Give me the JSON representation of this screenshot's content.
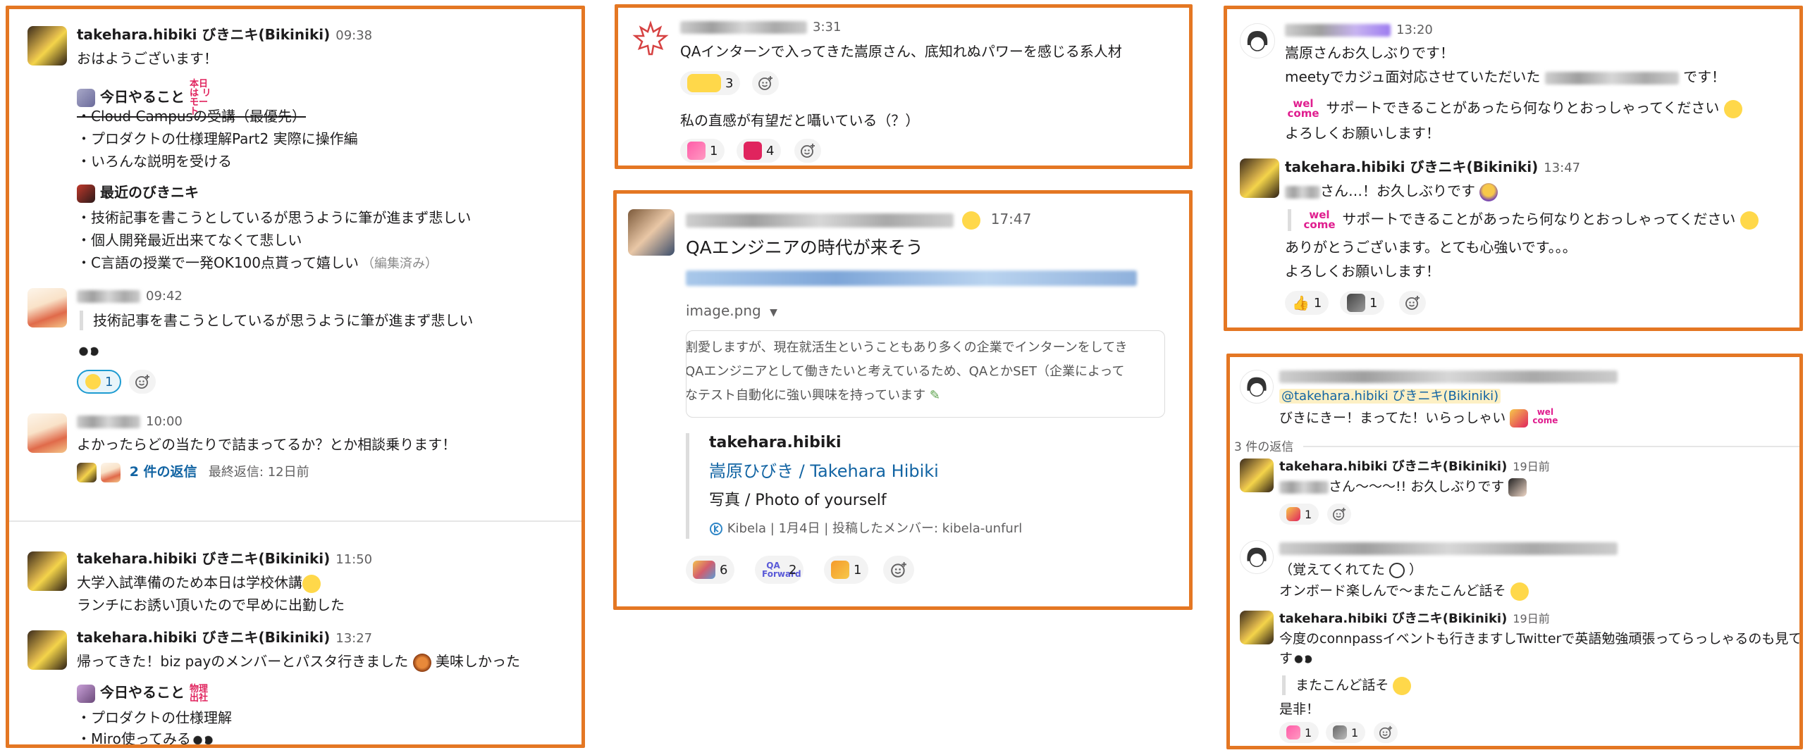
{
  "colors": {
    "panel_border": "#e47723",
    "link": "#1264a3",
    "muted": "#616061",
    "mention_bg": "#fdf0c4",
    "welcome_pink": "#e01e8f"
  },
  "p1": {
    "m1": {
      "name": "takehara.hibiki びきニキ(Bikiniki)",
      "time": "09:38",
      "text": "おはようございます！",
      "todo_title": "今日やること",
      "todo_badge": "本日は リモート",
      "todo": [
        "・Cloud Campusの受講（最優先）",
        "・プロダクトの仕様理解Part2 実際に操作編",
        "・いろんな説明を受ける"
      ],
      "recent_title": "最近のびきニキ",
      "recent": [
        "・技術記事を書こうとしているが思うように筆が進まず悲しい",
        "・個人開発最近出来てなくて悲しい",
        "・C言語の授業で一発OK100点貰って嬉しい"
      ],
      "edited": "（編集済み）"
    },
    "m2": {
      "time": "09:42",
      "quote": "技術記事を書こうとしているが思うように筆が進まず悲しい",
      "react_count": "1"
    },
    "m3": {
      "time": "10:00",
      "text": "よかったらどの当たりで詰まってるか？とか相談乗ります！",
      "replies": "2 件の返信",
      "last_reply": "最終返信: 12日前"
    },
    "m4": {
      "name": "takehara.hibiki びきニキ(Bikiniki)",
      "time": "11:50",
      "lines": [
        "大学入試準備のため本日は学校休講",
        "ランチにお誘い頂いたので早めに出勤した"
      ]
    },
    "m5": {
      "name": "takehara.hibiki びきニキ(Bikiniki)",
      "time": "13:27",
      "text": "帰ってきた！biz payのメンバーとパスタ行きました",
      "text2": "美味しかった",
      "todo_title": "今日やること",
      "todo_badge": "物理 出社",
      "todo": [
        "・プロダクトの仕様理解",
        "・Miro使ってみる"
      ]
    }
  },
  "p2": {
    "time": "3:31",
    "text": "QAインターンで入ってきた嵩原さん、底知れぬパワーを感じる系人材",
    "react1": "3",
    "text2": "私の直感が有望だと囁いている（？）",
    "react2a": "1",
    "react2b": "4"
  },
  "p3": {
    "time": "17:47",
    "title": "QAエンジニアの時代が来そう",
    "file": "image.png",
    "img_lines": [
      "割愛しますが、現在就活生ということもあり多くの企業でインターンをしてき",
      "QAエンジニアとして働きたいと考えているため、QAとかSET（企業によって",
      "なテスト自動化に強い興味を持っています"
    ],
    "unfurl_author": "takehara.hibiki",
    "unfurl_title": "嵩原ひびき / Takehara Hibiki",
    "unfurl_desc": "写真 / Photo of yourself",
    "unfurl_meta": [
      "Kibela",
      "1月4日",
      "投稿したメンバー: kibela-unfurl"
    ],
    "reacts": [
      "6",
      "2",
      "1"
    ]
  },
  "p4": {
    "time": "13:20",
    "lines": [
      "嵩原さんお久しぶりです！",
      "meetyでカジュ面対応させていただいた",
      "です！",
      "サポートできることがあったら何なりとおっしゃってください",
      "よろしくお願いします！"
    ],
    "reply": {
      "name": "takehara.hibiki びきニキ(Bikiniki)",
      "time": "13:47",
      "lines": [
        "さん…！お久しぶりです",
        "サポートできることがあったら何なりとおっしゃってください",
        "ありがとうございます。とても心強いです。。。",
        "よろしくお願いします！"
      ],
      "reacts": [
        "1",
        "1"
      ]
    }
  },
  "p5": {
    "mention": "@takehara.hibiki びきニキ(Bikiniki)",
    "text": "びきにきー！まってた！いらっしゃい",
    "replies_label": "3 件の返信",
    "r1": {
      "name": "takehara.hibiki びきニキ(Bikiniki)",
      "time": "19日前",
      "text": "さん〜〜〜!! お久しぶりです",
      "react": "1"
    },
    "r2": {
      "lines": [
        "（覚えてくれてた",
        "）",
        "オンボード楽しんで〜またこんど話そ"
      ]
    },
    "r3": {
      "name": "takehara.hibiki びきニキ(Bikiniki)",
      "time": "19日前",
      "lines": [
        "今度のconnpassイベントも行きますしTwitterで英語勉強頑張ってらっしゃるのも見てま",
        "す",
        "またこんど話そ",
        "是非！"
      ],
      "reacts": [
        "1",
        "1"
      ]
    }
  }
}
